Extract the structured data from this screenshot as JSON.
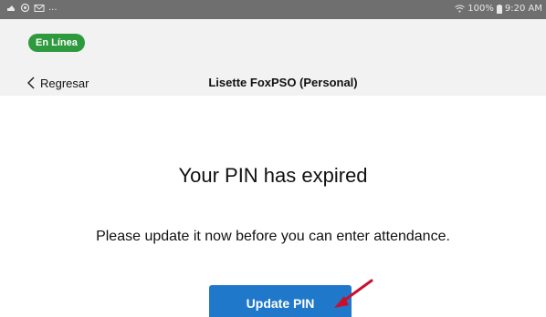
{
  "status_bar": {
    "icons_left": [
      "cloud-icon",
      "sync-icon",
      "mail-icon"
    ],
    "more": "...",
    "battery": "100%",
    "time": "9:20 AM",
    "icons_right": [
      "wifi-icon",
      "battery-icon"
    ]
  },
  "header": {
    "online_badge": "En Línea",
    "back_label": "Regresar",
    "title": "Lisette FoxPSO (Personal)"
  },
  "main": {
    "title": "Your PIN has expired",
    "message": "Please update it now before you can enter attendance.",
    "update_button_label": "Update PIN"
  },
  "colors": {
    "status_bar_bg": "#6f6f6f",
    "header_bg": "#f2f2f2",
    "badge_green": "#2e9a3e",
    "button_blue": "#1f78c9",
    "annotation_red": "#c8102e"
  }
}
